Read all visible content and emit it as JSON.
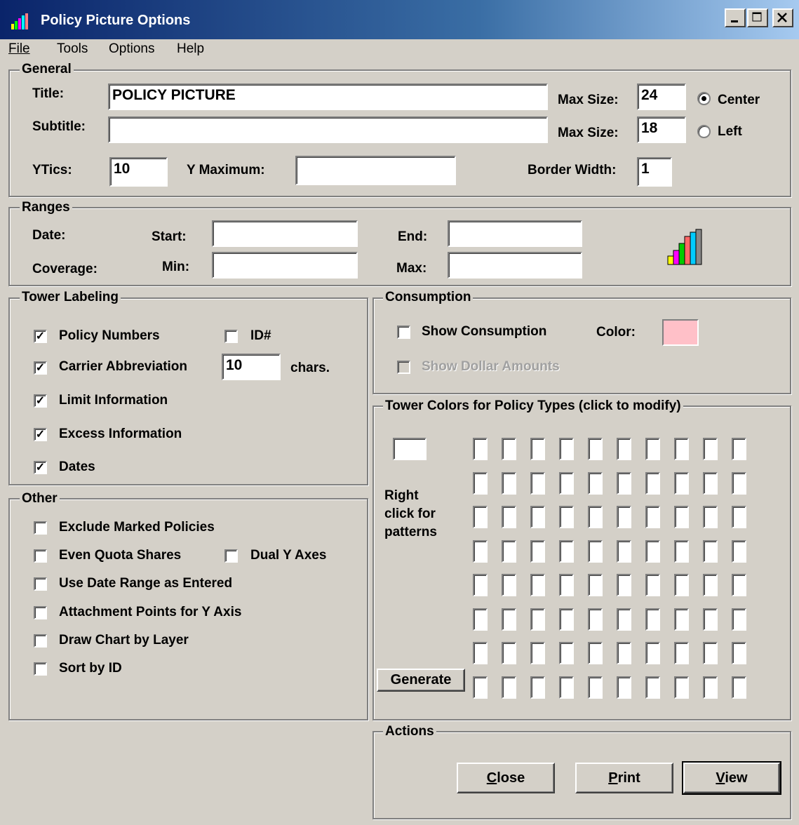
{
  "window": {
    "title": "Policy Picture Options"
  },
  "menu": {
    "file": "File",
    "tools": "Tools",
    "options": "Options",
    "help": "Help"
  },
  "general": {
    "legend": "General",
    "title_label": "Title:",
    "title_value": "POLICY PICTURE",
    "subtitle_label": "Subtitle:",
    "subtitle_value": "",
    "max_size_label_1": "Max Size:",
    "max_size_value_1": "24",
    "max_size_label_2": "Max Size:",
    "max_size_value_2": "18",
    "align_center": "Center",
    "align_left": "Left",
    "align_selected": "Center",
    "ytics_label": "YTics:",
    "ytics_value": "10",
    "ymax_label": "Y Maximum:",
    "ymax_value": "",
    "border_label": "Border Width:",
    "border_value": "1"
  },
  "ranges": {
    "legend": "Ranges",
    "date_label": "Date:",
    "coverage_label": "Coverage:",
    "start_label": "Start:",
    "end_label": "End:",
    "min_label": "Min:",
    "max_label": "Max:",
    "start_value": "",
    "end_value": "",
    "min_value": "",
    "max_value": ""
  },
  "tower_labeling": {
    "legend": "Tower Labeling",
    "policy_numbers": "Policy Numbers",
    "policy_numbers_checked": true,
    "id": "ID#",
    "id_checked": false,
    "carrier_abbrev": "Carrier Abbreviation",
    "carrier_abbrev_checked": true,
    "chars_value": "10",
    "chars_label": "chars.",
    "limit_info": "Limit Information",
    "limit_info_checked": true,
    "excess_info": "Excess Information",
    "excess_info_checked": true,
    "dates": "Dates",
    "dates_checked": true
  },
  "consumption": {
    "legend": "Consumption",
    "show_consumption": "Show Consumption",
    "show_consumption_checked": false,
    "color_label": "Color:",
    "color_value": "#ffc0c8",
    "show_dollar": "Show Dollar Amounts",
    "show_dollar_disabled": true
  },
  "tower_colors": {
    "legend": "Tower Colors for Policy Types (click to modify)",
    "hint_1": "Right",
    "hint_2": "click for",
    "hint_3": "patterns",
    "generate_label": "Generate",
    "rows": 8,
    "cols": 10
  },
  "other": {
    "legend": "Other",
    "exclude_marked": "Exclude Marked Policies",
    "even_quota": "Even Quota Shares",
    "dual_y": "Dual Y Axes",
    "use_date_range": "Use Date Range as Entered",
    "attachment_points": "Attachment Points for Y Axis",
    "draw_by_layer": "Draw Chart by Layer",
    "sort_by_id": "Sort by ID"
  },
  "actions": {
    "legend": "Actions",
    "close_c": "C",
    "close_rest": "lose",
    "print_p": "P",
    "print_rest": "rint",
    "view_v": "V",
    "view_rest": "iew"
  }
}
